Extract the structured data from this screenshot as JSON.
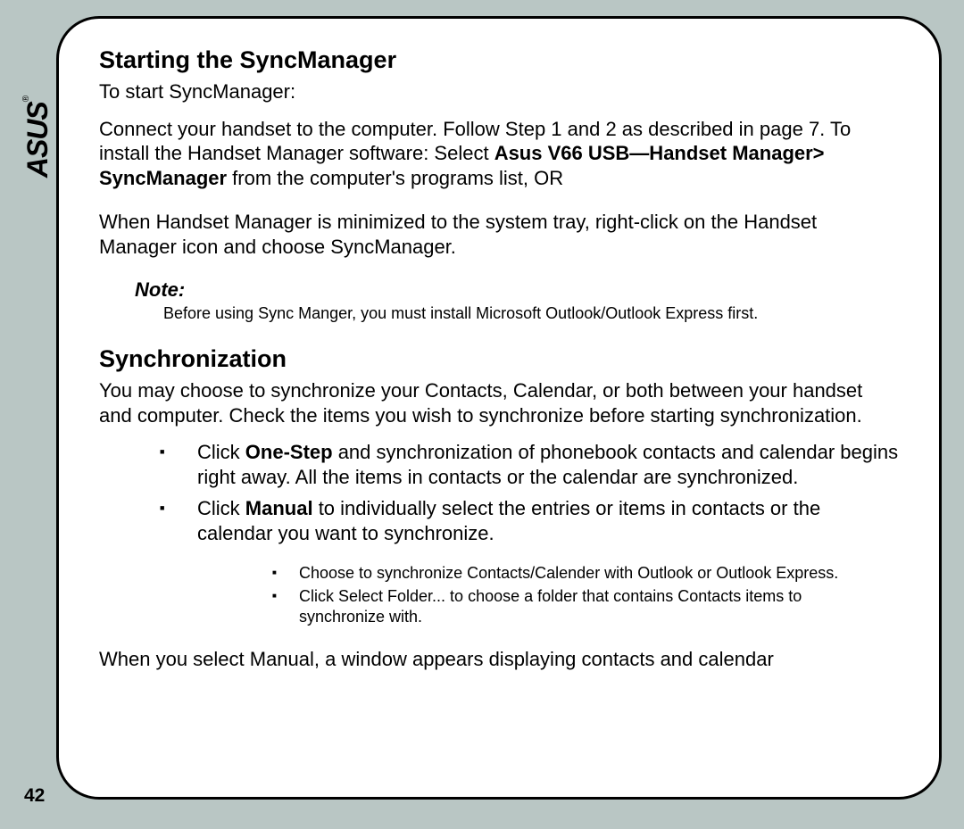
{
  "logo": "ASUS",
  "pageNumber": "42",
  "section1": {
    "title": "Starting the SyncManager",
    "intro": "To start SyncManager:",
    "para1_a": "Connect your handset to the computer. Follow Step 1 and 2 as described in page 7. To install the Handset Manager software: Select ",
    "para1_bold1": "Asus V66 USB—Handset Manager> SyncManager",
    "para1_b": " from the computer's programs list, OR",
    "para2": "When Handset Manager is minimized to the system tray, right-click on the Handset Manager icon and choose SyncManager.",
    "noteLabel": "Note:",
    "noteText": "Before using Sync Manger, you must install Microsoft Outlook/Outlook Express first."
  },
  "section2": {
    "title": "Synchronization",
    "para1": "You may choose to synchronize your Contacts, Calendar, or both between your handset and computer. Check the items you wish to synchronize before starting synchronization.",
    "bullet1_a": "Click ",
    "bullet1_bold": "One-Step",
    "bullet1_b": " and synchronization of phonebook contacts and calendar begins right away. All the items in contacts or the calendar are synchronized.",
    "bullet2_a": "Click ",
    "bullet2_bold": "Manual",
    "bullet2_b": " to individually select the entries or items in contacts or the calendar you want to synchronize.",
    "sub1": "Choose to synchronize Contacts/Calender with Outlook or Outlook Express.",
    "sub2": "Click Select Folder... to choose a folder that contains Contacts items to synchronize with.",
    "para2": "When you select Manual, a window appears displaying contacts and calendar"
  }
}
